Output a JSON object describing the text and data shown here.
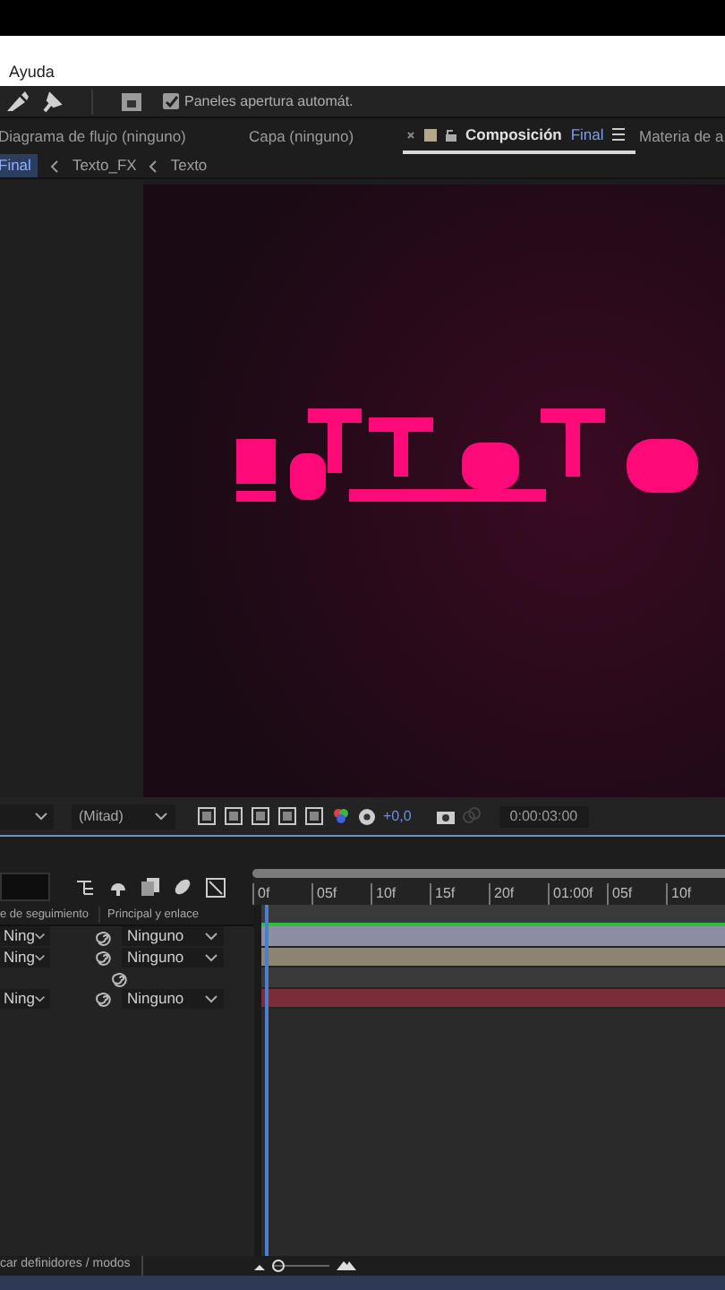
{
  "menu": {
    "items": [
      "Ayuda"
    ]
  },
  "toolbar": {
    "auto_open": {
      "label": "Paneles apertura automát.",
      "checked": true
    }
  },
  "panel_tabs": [
    {
      "label": "Diagrama de flujo (ninguno)",
      "selected": false
    },
    {
      "label": "Capa (ninguno)",
      "selected": false
    },
    {
      "label": "Composición",
      "comp": "Final",
      "selected": true
    },
    {
      "label": "Materia de a",
      "selected": false
    }
  ],
  "breadcrumb": [
    {
      "label": "Final",
      "selected": true
    },
    {
      "label": "Texto_FX",
      "selected": false
    },
    {
      "label": "Texto",
      "selected": false
    }
  ],
  "viewer_controls": {
    "resolution": "(Mitad)",
    "exposure": "+0,0",
    "timecode": "0:00:03:00"
  },
  "timeline": {
    "ruler": [
      "0f",
      "05f",
      "10f",
      "15f",
      "20f",
      "01:00f",
      "05f",
      "10f"
    ],
    "columns": [
      "e de seguimiento",
      "Principal y enlace"
    ],
    "layers": [
      {
        "kind": "full",
        "track": "Ning",
        "parent": "Ninguno",
        "color": "#8c8ca3"
      },
      {
        "kind": "full",
        "track": "Ning",
        "parent": "Ninguno",
        "color": "#8a8470"
      },
      {
        "kind": "compact",
        "color": "#3a3a3a"
      },
      {
        "kind": "full",
        "track": "Ning",
        "parent": "Ninguno",
        "color": "#7a2d38"
      }
    ],
    "status": "car definidores / modos",
    "zoom": {
      "level": 0.1
    }
  }
}
